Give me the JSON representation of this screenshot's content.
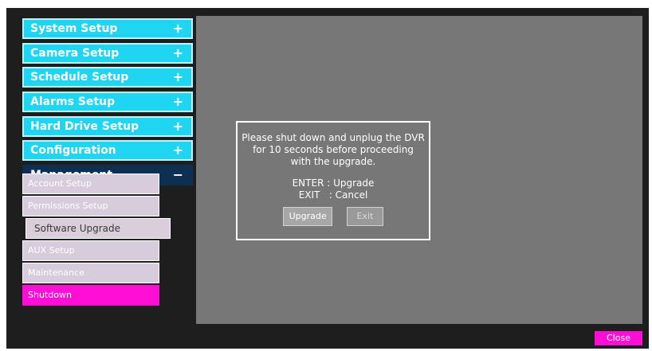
{
  "menu": {
    "items": [
      {
        "label": "System Setup",
        "sign": "+"
      },
      {
        "label": "Camera Setup",
        "sign": "+"
      },
      {
        "label": "Schedule Setup",
        "sign": "+"
      },
      {
        "label": "Alarms Setup",
        "sign": "+"
      },
      {
        "label": "Hard Drive Setup",
        "sign": "+"
      },
      {
        "label": "Configuration",
        "sign": "+"
      },
      {
        "label": "Management",
        "sign": "−"
      }
    ],
    "submenu": [
      "Account Setup",
      "Permissions Setup",
      "Software Upgrade",
      "AUX Setup",
      "Maintenance",
      "Shutdown"
    ]
  },
  "dialog": {
    "line1": "Please shut down and unplug the DVR",
    "line2": "for 10 seconds before proceeding",
    "line3": "with the upgrade.",
    "enter_text": "ENTER : Upgrade",
    "exit_text": "EXIT   : Cancel",
    "upgrade_button": "Upgrade",
    "exit_button": "Exit"
  },
  "close_button": "Close",
  "colors": {
    "menu_bg": "#1fd5f2",
    "active_bg": "#0c2f52",
    "submenu_bg": "#d6ccdc",
    "accent_pink": "#ff0fd6",
    "content_bg": "#777777",
    "screen_bg": "#1e1e1e"
  }
}
